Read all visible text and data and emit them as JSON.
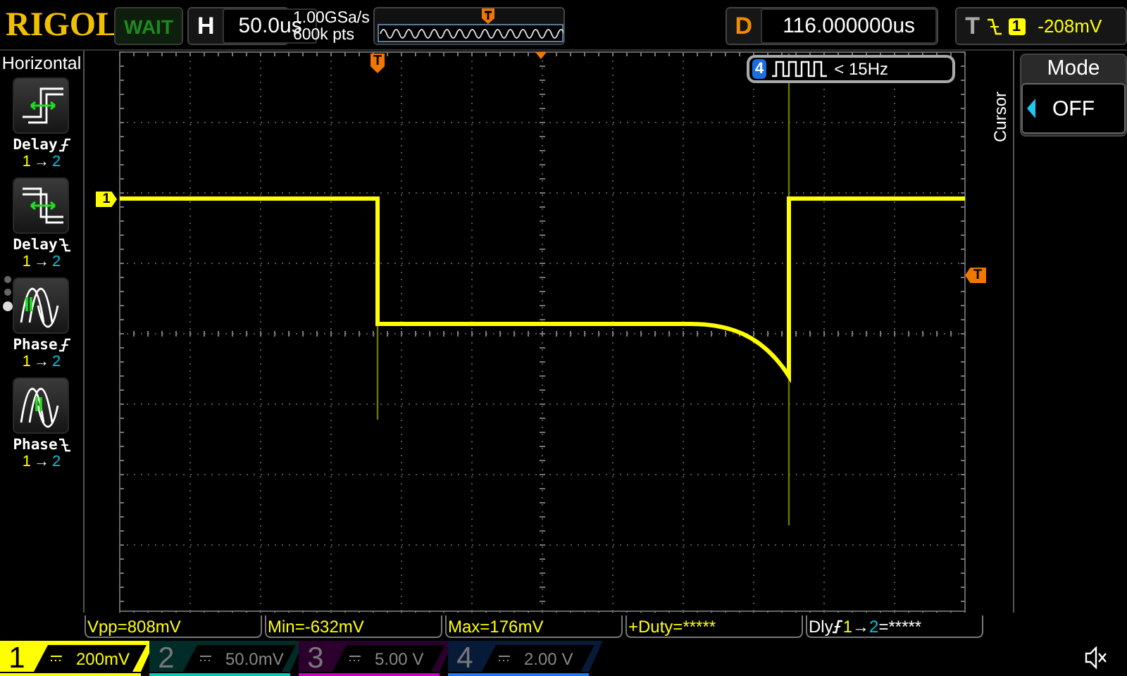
{
  "top_bar": {
    "logo": "RIGOL",
    "run_status": "WAIT",
    "timebase": {
      "label": "H",
      "value": "50.0us"
    },
    "sample_rate": "1.00GSa/s",
    "memory_depth": "600k pts",
    "delay": {
      "label": "D",
      "value": "116.000000us"
    },
    "trigger": {
      "label": "T",
      "kind": "falling",
      "source": "1",
      "level": "-208mV"
    }
  },
  "menu": {
    "title": "Horizontal",
    "items": [
      {
        "kind": "delayrise",
        "label": "Delay",
        "from": "1",
        "arrow": "→",
        "to": "2"
      },
      {
        "kind": "delayfall",
        "label": "Delay",
        "from": "1",
        "arrow": "→",
        "to": "2"
      },
      {
        "kind": "phaserise",
        "label": "Phase",
        "from": "1",
        "arrow": "→",
        "to": "2"
      },
      {
        "kind": "phasefall",
        "label": "Phase",
        "from": "1",
        "arrow": "→",
        "to": "2"
      }
    ],
    "pages": [
      {
        "selected": false
      },
      {
        "selected": false
      },
      {
        "selected": true
      }
    ]
  },
  "frequency_counter": {
    "channel": "4",
    "reading": "< 15Hz"
  },
  "markers": {
    "channel": "1",
    "trigger": "T",
    "trigger_position": "T"
  },
  "side_panel": {
    "tab": "Cursor",
    "title": "Mode",
    "value": "OFF"
  },
  "measurements": [
    {
      "kind": "text",
      "text": "Vpp=808mV"
    },
    {
      "kind": "text",
      "text": "Min=-632mV"
    },
    {
      "kind": "text",
      "text": "Max=176mV"
    },
    {
      "kind": "text",
      "text": "+Duty=*****"
    },
    {
      "kind": "delayrise",
      "label": "Dly",
      "from": "1",
      "arrow": "→",
      "to": "2",
      "value": "=*****"
    }
  ],
  "channels": [
    {
      "number": "1",
      "scale": "200mV",
      "on": true,
      "color": "#ffff00"
    },
    {
      "number": "2",
      "scale": "50.0mV",
      "on": false,
      "color": "#00c8b4"
    },
    {
      "number": "3",
      "scale": "5.00 V",
      "on": false,
      "color": "#c800c8"
    },
    {
      "number": "4",
      "scale": "2.00 V",
      "on": false,
      "color": "#1e78ff"
    }
  ]
}
